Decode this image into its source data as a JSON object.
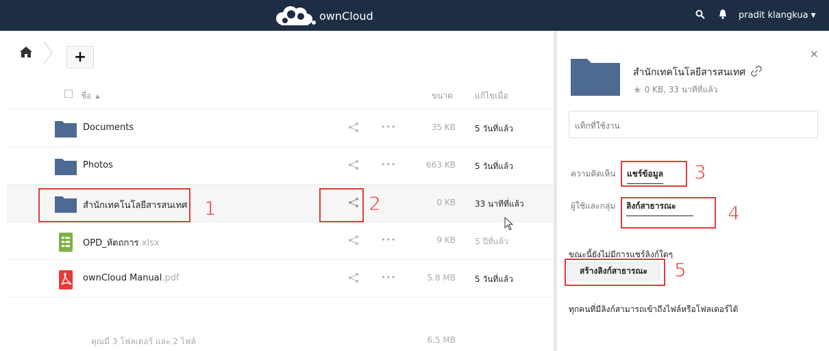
{
  "header": {
    "brand": "ownCloud",
    "user": "pradit klangkua",
    "icons": [
      "search-icon",
      "bell-icon",
      "caret-down-icon"
    ],
    "background": "#1d2d44"
  },
  "controls": {
    "add_label": "+"
  },
  "table": {
    "col_name": "ชื่อ",
    "col_size": "ขนาด",
    "col_modified": "แก้ไขเมื่อ",
    "rows": [
      {
        "name": "Documents",
        "ext": "",
        "size": "35 KB",
        "modified": "5 วันที่แล้ว",
        "type": "folder"
      },
      {
        "name": "Photos",
        "ext": "",
        "size": "663 KB",
        "modified": "5 วันที่แล้ว",
        "type": "folder"
      },
      {
        "name": "สำนักเทคโนโลยีสารสนเทศ",
        "ext": "",
        "size": "0 KB",
        "modified": "33 นาทีที่แล้ว",
        "type": "folder"
      },
      {
        "name": "OPD_หัตถการ",
        "ext": ".xlsx",
        "size": "9 KB",
        "modified": "5 ปีที่แล้ว",
        "type": "spreadsheet"
      },
      {
        "name": "ownCloud Manual",
        "ext": ".pdf",
        "size": "5.8 MB",
        "modified": "5 วันที่แล้ว",
        "type": "pdf"
      }
    ],
    "more_glyph": "•••",
    "summary_text": "คุณมี 3 โฟลเดอร์ และ 2 ไฟล์",
    "summary_size": "6.5 MB"
  },
  "sidebar": {
    "close": "×",
    "title": "สำนักเทคโนโลยีสารสนเทศ",
    "meta": "0 KB, 33 นาทีที่แล้ว",
    "tags_placeholder": "แท็กที่ใช้งาน",
    "tab_comments": "ความคิดเห็น",
    "tab_sharing": "แชร์ข้อมูล",
    "users_groups": "ผู้ใช้และกลุ่ม",
    "public_links": "ลิงก์สาธารณะ",
    "no_links": "ขณะนี้ยังไม่มีการแชร์ลิงก์ใดๆ",
    "create_link": "สร้างลิงก์สาธารณะ",
    "link_note": "ทุกคนที่มีลิงก์สามารถเข้าถึงไฟล์หรือโฟลเดอร์ได้"
  },
  "annotations": [
    "1",
    "2",
    "3",
    "4",
    "5"
  ],
  "colors": {
    "folder": "#4e6a92",
    "highlight": "#e53935",
    "spreadsheet": "#7cb342",
    "pdf": "#e53935"
  }
}
